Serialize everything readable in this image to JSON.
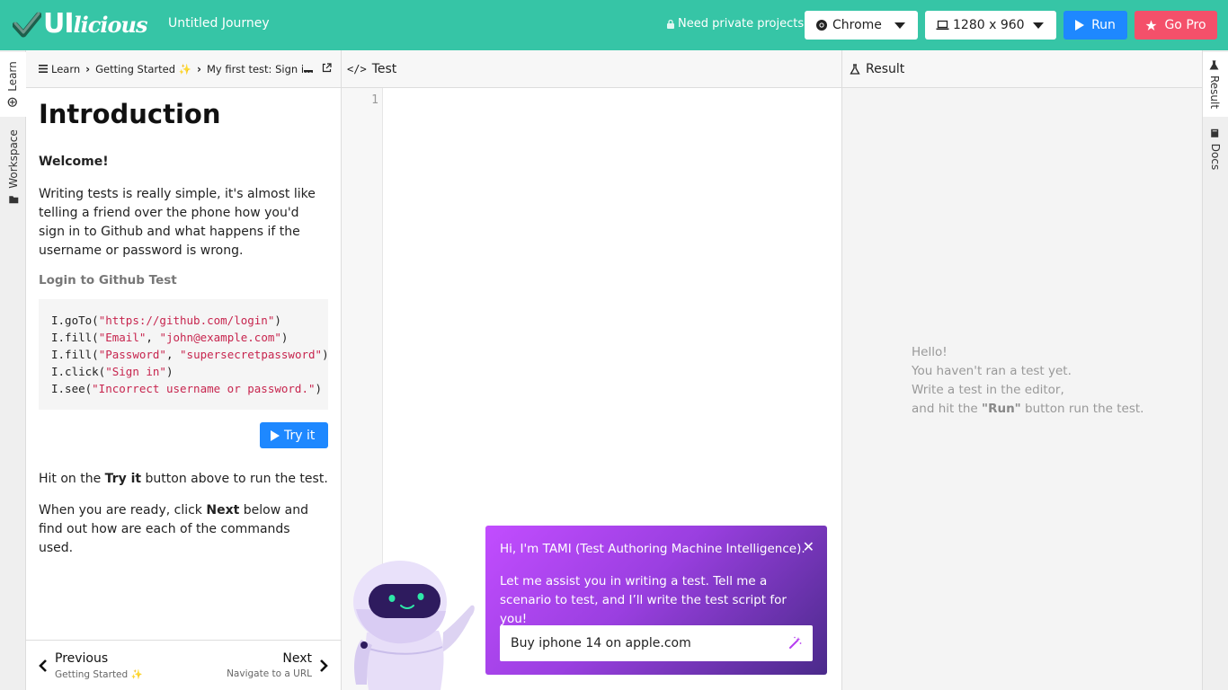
{
  "app": {
    "logo_main": "UI",
    "logo_italic": "licious",
    "journey_title": "Untitled Journey",
    "private_prompt": "Need private projects?"
  },
  "toolbar": {
    "browser_value": "Chrome",
    "resolution_value": "1280 x 960",
    "run_label": "Run",
    "gopro_label": "Go Pro"
  },
  "left_tabs": [
    "Learn",
    "Workspace"
  ],
  "right_tabs": [
    "Result",
    "Docs"
  ],
  "learn": {
    "breadcrumb": [
      "Learn",
      "Getting Started ✨",
      "My first test: Sign i..."
    ],
    "title": "Introduction",
    "welcome": "Welcome!",
    "intro_para": "Writing tests is really simple, it's almost like telling a friend over the phone how you'd sign in to Github and what happens if the username or password is wrong.",
    "example_heading": "Login to Github Test",
    "code_lines": [
      {
        "fn": "I.goTo(",
        "args": [
          {
            "s": "\"https://github.com/login\""
          }
        ],
        "end": ")"
      },
      {
        "fn": "I.fill(",
        "args": [
          {
            "s": "\"Email\""
          },
          {
            "p": ", "
          },
          {
            "s": "\"john@example.com\""
          }
        ],
        "end": ")"
      },
      {
        "fn": "I.fill(",
        "args": [
          {
            "s": "\"Password\""
          },
          {
            "p": ", "
          },
          {
            "s": "\"supersecretpassword\""
          }
        ],
        "end": ")"
      },
      {
        "fn": "I.click(",
        "args": [
          {
            "s": "\"Sign in\""
          }
        ],
        "end": ")"
      },
      {
        "fn": "I.see(",
        "args": [
          {
            "s": "\"Incorrect username or password.\""
          }
        ],
        "end": ")"
      }
    ],
    "tryit_label": "Try it",
    "hint_pre": "Hit on the ",
    "hint_bold": "Try it",
    "hint_post": " button above to run the test.",
    "ready_pre": "When you are ready, click ",
    "ready_bold": "Next",
    "ready_post": " below and find out how are each of the commands used.",
    "prev_label": "Previous",
    "prev_sub": "Getting Started ✨",
    "next_label": "Next",
    "next_sub": "Navigate to a URL"
  },
  "test": {
    "header": "Test",
    "line_numbers": [
      "1"
    ]
  },
  "result": {
    "header": "Result",
    "msg_line1": "Hello!",
    "msg_line2": "You haven't ran a test yet.",
    "msg_line3": "Write a test in the editor,",
    "msg_line4_pre": "and hit the ",
    "msg_line4_bold": "\"Run\"",
    "msg_line4_post": " button run the test."
  },
  "tami": {
    "title": "Hi, I'm TAMI (Test Authoring Machine Intelligence).",
    "body": "Let me assist you in writing a test. Tell me a scenario to test, and I’ll write the test script for you!",
    "input_value": "Buy iphone 14 on apple.com",
    "close_glyph": "✕"
  },
  "colors": {
    "brand_teal": "#36c5a6",
    "run_blue": "#1e88ff",
    "gopro_red": "#f4506a",
    "code_string": "#c7254e"
  }
}
